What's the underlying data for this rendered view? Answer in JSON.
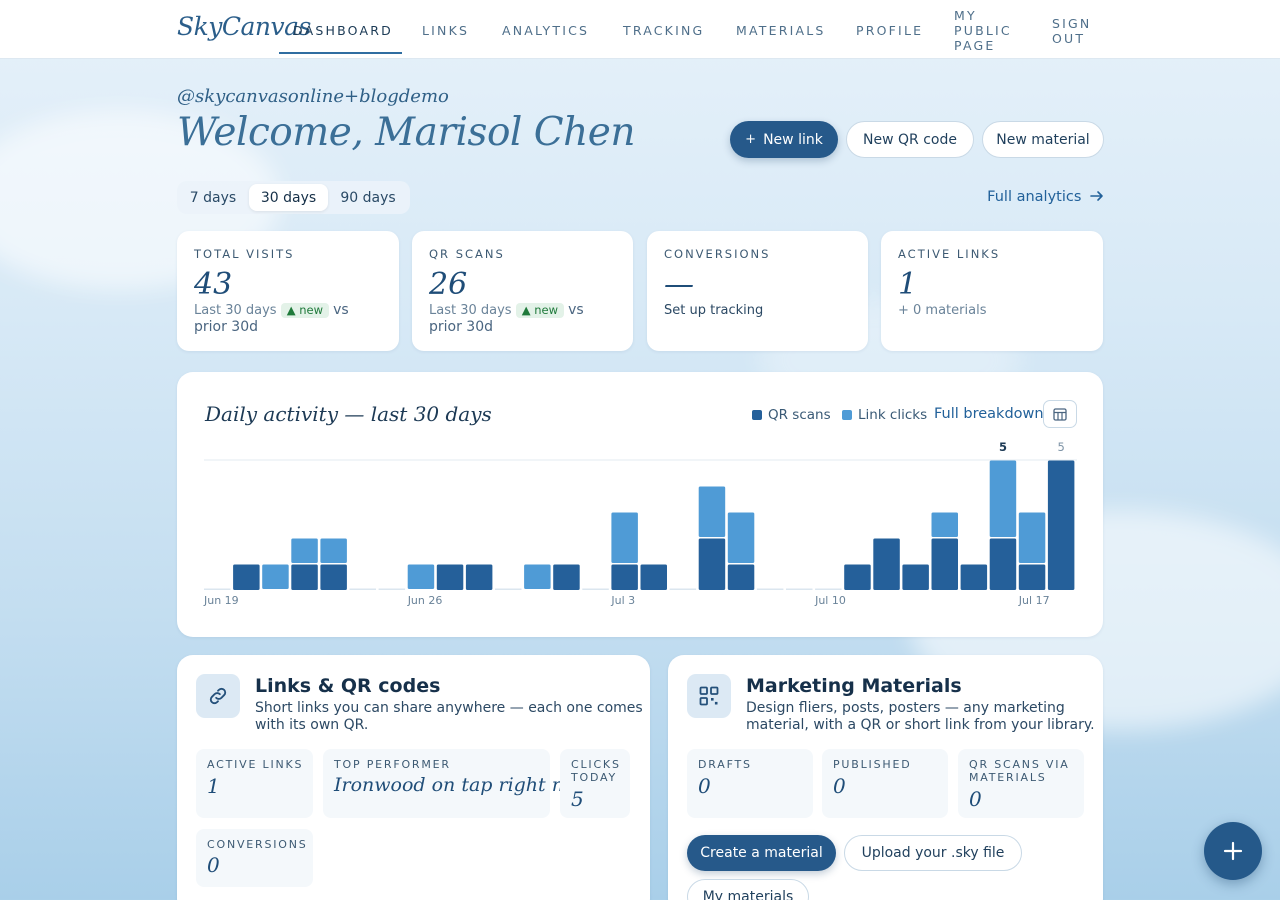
{
  "brand": {
    "logo": "SkyCanvas"
  },
  "nav": {
    "dashboard": "DASHBOARD",
    "links": "LINKS",
    "analytics": "ANALYTICS",
    "tracking": "TRACKING",
    "materials": "MATERIALS",
    "profile": "PROFILE",
    "public_page": [
      "MY",
      "PUBLIC",
      "PAGE"
    ],
    "sign_out": [
      "SIGN",
      "OUT"
    ]
  },
  "header": {
    "handle": "@skycanvasonline+blogdemo",
    "welcome": "Welcome, Marisol Chen",
    "new_link": "New link",
    "new_link_icon": "plus-icon",
    "new_qr": "New QR code",
    "new_material": "New material"
  },
  "range": {
    "tabs": [
      "7 days",
      "30 days",
      "90 days"
    ],
    "selected": "30 days",
    "full_analytics": "Full analytics"
  },
  "stats": [
    {
      "label": "TOTAL VISITS",
      "value": "43",
      "sub_prefix": "Last 30 days",
      "badge": "▲ new",
      "sub_suffix": "vs prior 30d"
    },
    {
      "label": "QR SCANS",
      "value": "26",
      "sub_prefix": "Last 30 days",
      "badge": "▲ new",
      "sub_suffix": "vs prior 30d"
    },
    {
      "label": "CONVERSIONS",
      "value": "—",
      "sub": "Set up tracking"
    },
    {
      "label": "ACTIVE LINKS",
      "value": "1",
      "sub": "+ 0 materials"
    }
  ],
  "activity": {
    "title": "Daily activity — last 30 days",
    "legend_qr": "QR scans",
    "legend_clicks": "Link clicks",
    "full_breakdown": "Full breakdown",
    "colors": {
      "qr": "#25609a",
      "clicks": "#4f9bd6",
      "baseline": "#dbe6ef"
    }
  },
  "chart_data": {
    "type": "bar",
    "stacked": true,
    "x_tick_labels": [
      "Jun 19",
      "Jun 26",
      "Jul 3",
      "Jul 10",
      "Jul 17"
    ],
    "x_tick_indices": [
      0,
      7,
      14,
      21,
      28
    ],
    "series": [
      {
        "name": "QR scans",
        "values": [
          0,
          1,
          0,
          1,
          1,
          0,
          0,
          0,
          1,
          1,
          0,
          0,
          1,
          0,
          1,
          1,
          0,
          2,
          1,
          0,
          0,
          0,
          1,
          2,
          1,
          2,
          1,
          2,
          1,
          5
        ]
      },
      {
        "name": "Link clicks",
        "values": [
          0,
          0,
          1,
          1,
          1,
          0,
          0,
          1,
          0,
          0,
          0,
          1,
          0,
          0,
          2,
          0,
          0,
          2,
          2,
          0,
          0,
          0,
          0,
          0,
          0,
          1,
          0,
          3,
          2,
          0
        ]
      }
    ],
    "ylim": [
      0,
      5
    ],
    "data_labels": [
      {
        "index": 27,
        "text": "5"
      },
      {
        "index": 29,
        "text": "5"
      }
    ]
  },
  "links_card": {
    "title": "Links & QR codes",
    "desc_lines": [
      "Short links you can share anywhere — each one comes",
      "with its own QR."
    ],
    "icon": "link-icon",
    "active_links_label": "ACTIVE LINKS",
    "active_links_value": "1",
    "top_performer_label": "TOP PERFORMER",
    "top_performer_value": "Ironwood on tap right now",
    "clicks_today_label": [
      "CLICKS",
      "TODAY"
    ],
    "clicks_today_value": "5",
    "conversions_label": "CONVERSIONS",
    "conversions_value": "0"
  },
  "materials_card": {
    "title": "Marketing Materials",
    "desc_lines": [
      "Design fliers, posts, posters — any marketing",
      "material, with a QR or short link from your library."
    ],
    "icon": "qr-code-icon",
    "drafts_label": "DRAFTS",
    "drafts_value": "0",
    "published_label": "PUBLISHED",
    "published_value": "0",
    "qr_scans_label": [
      "QR SCANS VIA",
      "MATERIALS"
    ],
    "qr_scans_value": "0",
    "create": "Create a material",
    "upload": "Upload your .sky file",
    "my_materials": "My materials"
  },
  "fab": {
    "icon": "plus-icon"
  }
}
